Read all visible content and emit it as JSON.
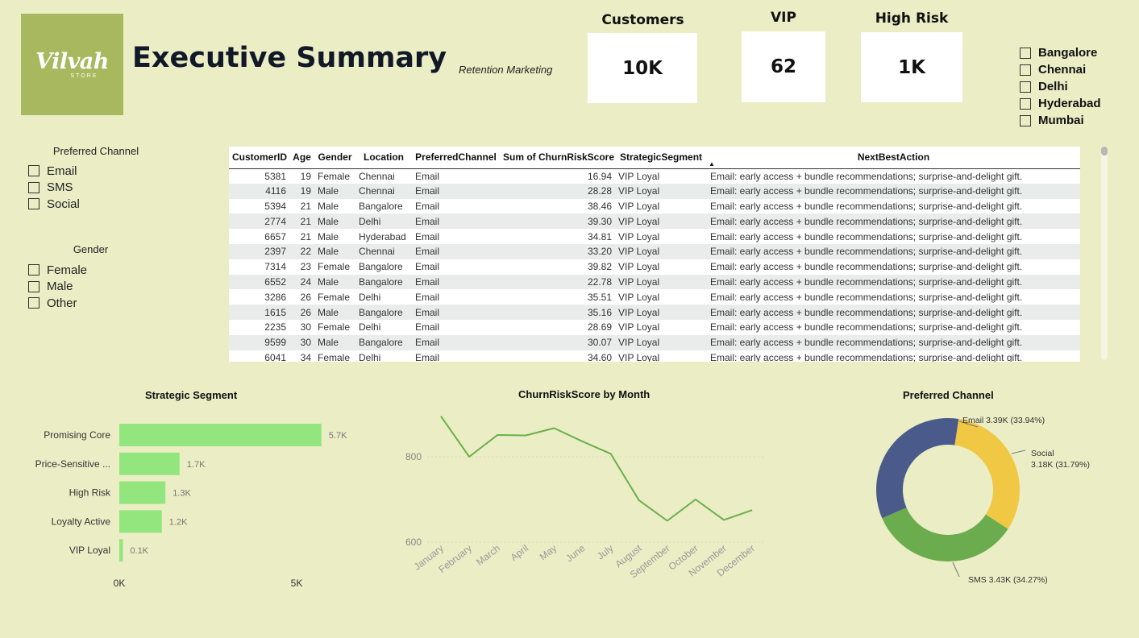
{
  "header": {
    "logo_text": "Vilvah",
    "logo_sub": "STORE",
    "title": "Executive Summary",
    "subtitle": "Retention Marketing"
  },
  "kpis": {
    "customers": {
      "label": "Customers",
      "value": "10K"
    },
    "vip": {
      "label": "VIP",
      "value": "62"
    },
    "high_risk": {
      "label": "High Risk",
      "value": "1K"
    }
  },
  "city_slicer": {
    "items": [
      "Bangalore",
      "Chennai",
      "Delhi",
      "Hyderabad",
      "Mumbai"
    ]
  },
  "channel_slicer": {
    "title": "Preferred Channel",
    "items": [
      "Email",
      "SMS",
      "Social"
    ]
  },
  "gender_slicer": {
    "title": "Gender",
    "items": [
      "Female",
      "Male",
      "Other"
    ]
  },
  "table": {
    "columns": [
      "CustomerID",
      "Age",
      "Gender",
      "Location",
      "PreferredChannel",
      "Sum of ChurnRiskScore",
      "StrategicSegment",
      "NextBestAction"
    ],
    "rows": [
      [
        "5381",
        "19",
        "Female",
        "Chennai",
        "Email",
        "16.94",
        "VIP Loyal",
        "Email: early access + bundle recommendations; surprise-and-delight gift."
      ],
      [
        "4116",
        "19",
        "Male",
        "Chennai",
        "Email",
        "28.28",
        "VIP Loyal",
        "Email: early access + bundle recommendations; surprise-and-delight gift."
      ],
      [
        "5394",
        "21",
        "Male",
        "Bangalore",
        "Email",
        "38.46",
        "VIP Loyal",
        "Email: early access + bundle recommendations; surprise-and-delight gift."
      ],
      [
        "2774",
        "21",
        "Male",
        "Delhi",
        "Email",
        "39.30",
        "VIP Loyal",
        "Email: early access + bundle recommendations; surprise-and-delight gift."
      ],
      [
        "6657",
        "21",
        "Male",
        "Hyderabad",
        "Email",
        "34.81",
        "VIP Loyal",
        "Email: early access + bundle recommendations; surprise-and-delight gift."
      ],
      [
        "2397",
        "22",
        "Male",
        "Chennai",
        "Email",
        "33.20",
        "VIP Loyal",
        "Email: early access + bundle recommendations; surprise-and-delight gift."
      ],
      [
        "7314",
        "23",
        "Female",
        "Bangalore",
        "Email",
        "39.82",
        "VIP Loyal",
        "Email: early access + bundle recommendations; surprise-and-delight gift."
      ],
      [
        "6552",
        "24",
        "Male",
        "Bangalore",
        "Email",
        "22.78",
        "VIP Loyal",
        "Email: early access + bundle recommendations; surprise-and-delight gift."
      ],
      [
        "3286",
        "26",
        "Female",
        "Delhi",
        "Email",
        "35.51",
        "VIP Loyal",
        "Email: early access + bundle recommendations; surprise-and-delight gift."
      ],
      [
        "1615",
        "26",
        "Male",
        "Bangalore",
        "Email",
        "35.16",
        "VIP Loyal",
        "Email: early access + bundle recommendations; surprise-and-delight gift."
      ],
      [
        "2235",
        "30",
        "Female",
        "Delhi",
        "Email",
        "28.69",
        "VIP Loyal",
        "Email: early access + bundle recommendations; surprise-and-delight gift."
      ],
      [
        "9599",
        "30",
        "Male",
        "Bangalore",
        "Email",
        "30.07",
        "VIP Loyal",
        "Email: early access + bundle recommendations; surprise-and-delight gift."
      ],
      [
        "6041",
        "34",
        "Female",
        "Delhi",
        "Email",
        "34.60",
        "VIP Loyal",
        "Email: early access + bundle recommendations; surprise-and-delight gift."
      ]
    ]
  },
  "chart_data": [
    {
      "type": "bar",
      "orientation": "horizontal",
      "title": "Strategic Segment",
      "categories": [
        "Promising Core",
        "Price-Sensitive ...",
        "High Risk",
        "Loyalty Active",
        "VIP Loyal"
      ],
      "values": [
        5700,
        1700,
        1300,
        1200,
        100
      ],
      "data_labels": [
        "5.7K",
        "1.7K",
        "1.3K",
        "1.2K",
        "0.1K"
      ],
      "xticks": [
        "0K",
        "5K"
      ],
      "xlim": [
        0,
        5000
      ],
      "color": "#93e67d"
    },
    {
      "type": "line",
      "title": "ChurnRiskScore by Month",
      "categories": [
        "January",
        "February",
        "March",
        "April",
        "May",
        "June",
        "July",
        "August",
        "September",
        "October",
        "November",
        "December"
      ],
      "values": [
        895,
        800,
        851,
        850,
        867,
        836,
        807,
        698,
        650,
        700,
        652,
        675
      ],
      "yticks": [
        "800",
        "600"
      ],
      "color": "#6bb04b"
    },
    {
      "type": "pie",
      "variant": "donut",
      "title": "Preferred Channel",
      "labels": [
        "Email",
        "Social",
        "SMS"
      ],
      "values": [
        3390,
        3180,
        3430
      ],
      "data_labels": [
        "Email 3.39K (33.94%)",
        "Social",
        "3.18K (31.79%)",
        "SMS 3.43K (34.27%)"
      ],
      "colors": [
        "#4a5a8a",
        "#f0c843",
        "#6bac4e"
      ]
    }
  ]
}
